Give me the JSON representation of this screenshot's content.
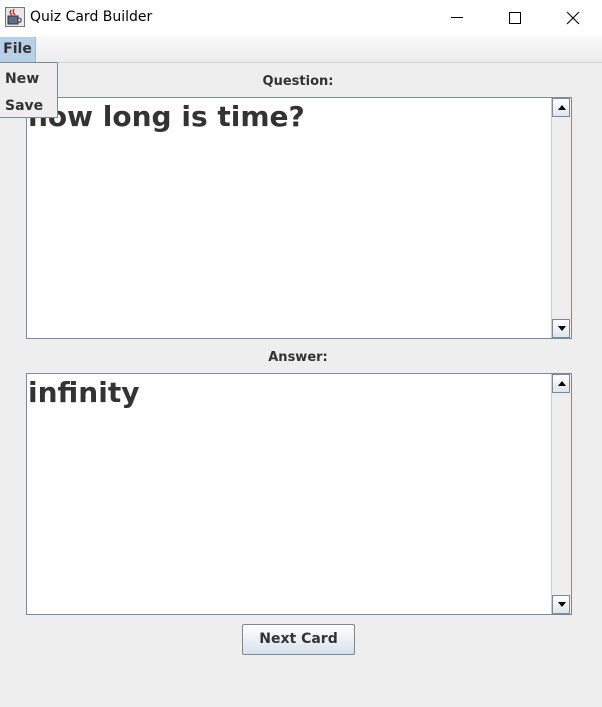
{
  "window": {
    "title": "Quiz Card Builder",
    "icons": {
      "app": "java-cup-icon",
      "minimize": "minimize-icon",
      "maximize": "maximize-icon",
      "close": "close-icon"
    }
  },
  "menubar": {
    "menus": [
      {
        "label": "File",
        "open": true,
        "items": [
          "New",
          "Save"
        ]
      }
    ]
  },
  "form": {
    "question_label": "Question:",
    "question_text": "how long is time?",
    "answer_label": "Answer:",
    "answer_text": "infinity",
    "next_button_label": "Next Card"
  },
  "colors": {
    "background": "#eeeeee",
    "menu_highlight": "#b8cfe5",
    "border": "#7a8a99",
    "text": "#333333"
  }
}
